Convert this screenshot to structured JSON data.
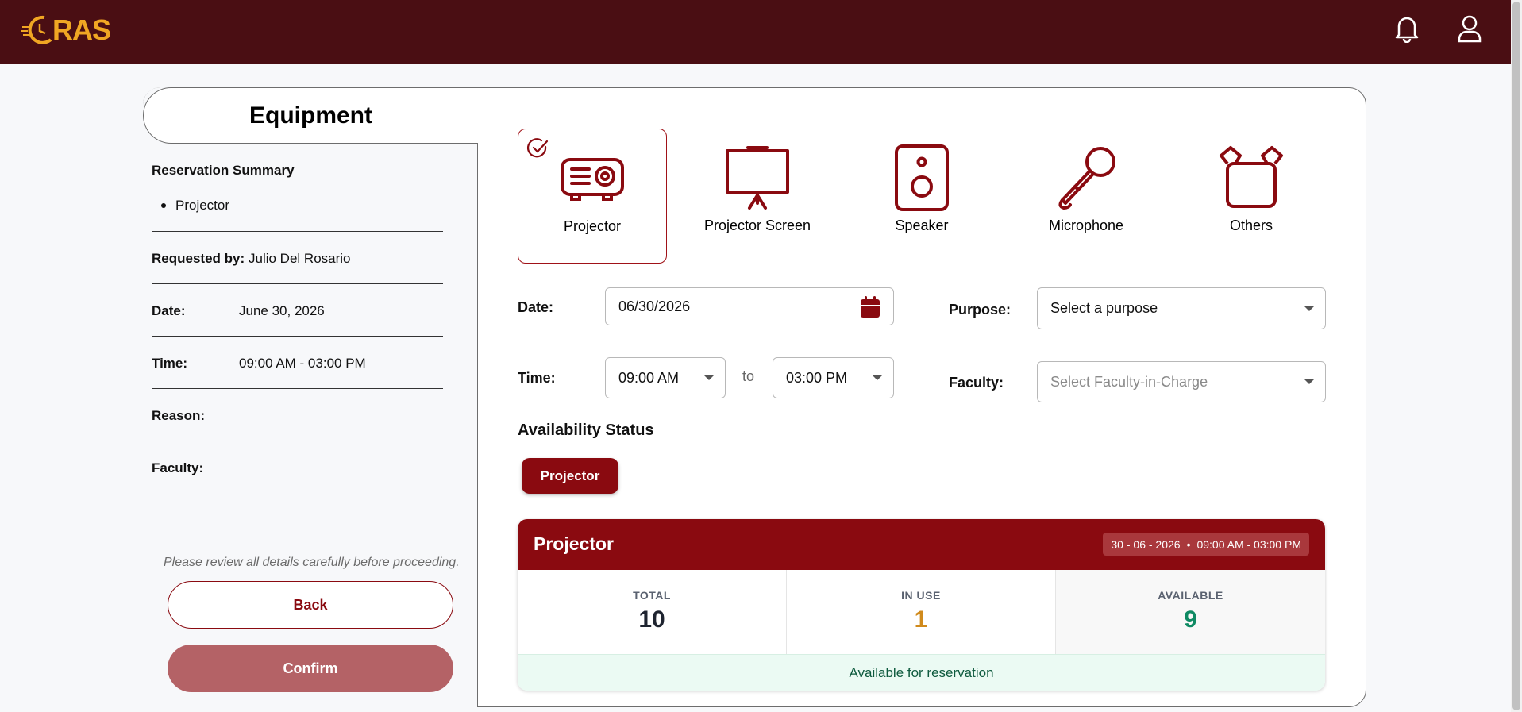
{
  "app": {
    "logo_text": "RAS"
  },
  "page": {
    "title": "Equipment"
  },
  "summary": {
    "heading": "Reservation Summary",
    "items": [
      "Projector"
    ],
    "requested_by_label": "Requested by:",
    "requested_by": "Julio Del Rosario",
    "date_label": "Date:",
    "date": "June 30, 2026",
    "time_label": "Time:",
    "time": "09:00 AM - 03:00 PM",
    "reason_label": "Reason:",
    "reason": "",
    "faculty_label": "Faculty:",
    "faculty": "",
    "note": "Please review all details carefully before proceeding.",
    "back_label": "Back",
    "confirm_label": "Confirm"
  },
  "equipment": [
    {
      "label": "Projector",
      "icon": "projector-icon",
      "selected": true
    },
    {
      "label": "Projector Screen",
      "icon": "projector-screen-icon",
      "selected": false
    },
    {
      "label": "Speaker",
      "icon": "speaker-icon",
      "selected": false
    },
    {
      "label": "Microphone",
      "icon": "microphone-icon",
      "selected": false
    },
    {
      "label": "Others",
      "icon": "box-icon",
      "selected": false
    }
  ],
  "form": {
    "date_label": "Date:",
    "date_value": "06/30/2026",
    "time_label": "Time:",
    "time_from": "09:00 AM",
    "time_to_word": "to",
    "time_to": "03:00 PM",
    "purpose_label": "Purpose:",
    "purpose_value": "Select a purpose",
    "faculty_label": "Faculty:",
    "faculty_placeholder": "Select Faculty-in-Charge"
  },
  "availability": {
    "title": "Availability Status",
    "chip": "Projector",
    "panel_title": "Projector",
    "badge_date": "30 - 06 - 2026",
    "badge_sep": "•",
    "badge_time": "09:00 AM - 03:00 PM",
    "total_label": "TOTAL",
    "total": "10",
    "in_use_label": "IN USE",
    "in_use": "1",
    "available_label": "AVAILABLE",
    "available": "9",
    "status": "Available for reservation"
  },
  "colors": {
    "header": "#4a0e13",
    "brand": "#8a0a10",
    "logo": "#f0a623",
    "in_use": "#d08a1c",
    "available": "#0f8a63"
  }
}
